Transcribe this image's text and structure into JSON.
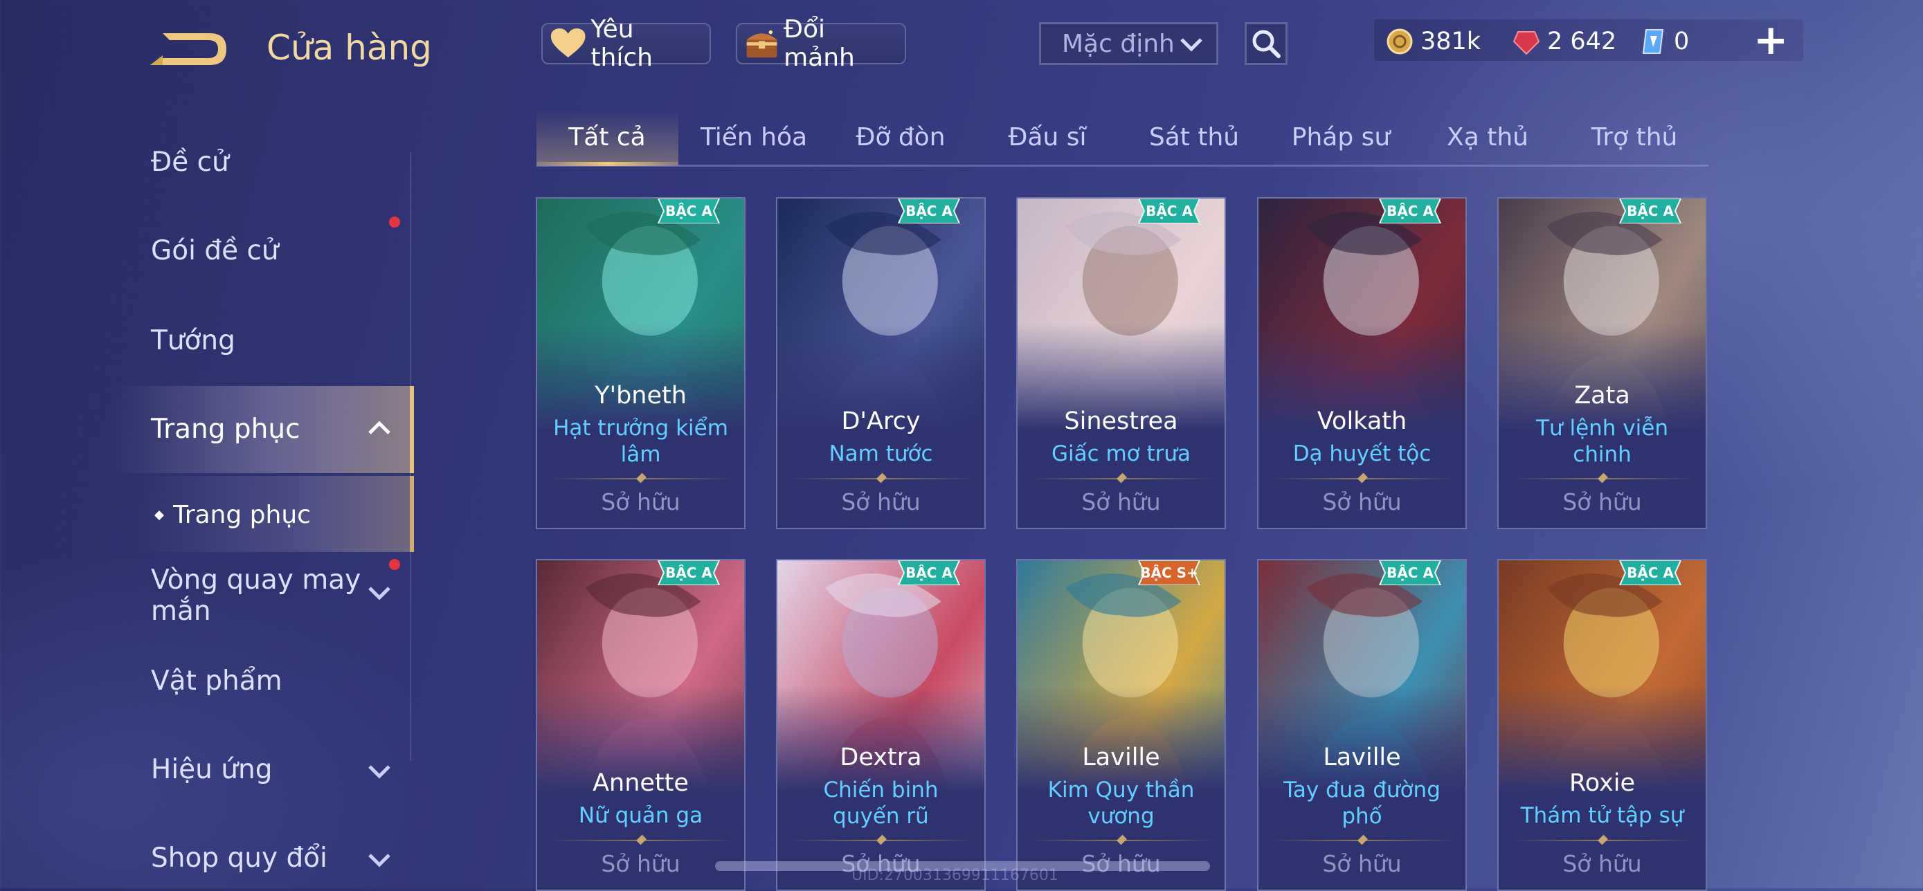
{
  "header": {
    "title": "Cửa hàng",
    "favorites_label": "Yêu thích",
    "exchange_label": "Đổi mảnh",
    "sort_value": "Mặc định",
    "currencies": [
      {
        "icon": "gold-coin-icon",
        "value": "381k"
      },
      {
        "icon": "red-gem-icon",
        "value": "2 642"
      },
      {
        "icon": "blue-ticket-icon",
        "value": "0"
      }
    ]
  },
  "sidebar": {
    "items": [
      {
        "label": "Đề cử"
      },
      {
        "label": "Gói đề cử"
      },
      {
        "label": "Tướng"
      },
      {
        "label": "Trang phục"
      },
      {
        "label": "Trang phục"
      },
      {
        "label": "Vòng quay may mắn"
      },
      {
        "label": "Vật phẩm"
      },
      {
        "label": "Hiệu ứng"
      },
      {
        "label": "Shop quy đổi"
      }
    ]
  },
  "tabs": [
    "Tất cả",
    "Tiến hóa",
    "Đỡ đòn",
    "Đấu sĩ",
    "Sát thủ",
    "Pháp sư",
    "Xạ thủ",
    "Trợ thủ"
  ],
  "cards": [
    {
      "hero": "Y'bneth",
      "skin": "Hạt trưởng kiểm lâm",
      "badge": "BẬC A",
      "status": "Sở hữu",
      "colors": [
        "#1d6b5a",
        "#2a8f86",
        "#7fe6d8"
      ]
    },
    {
      "hero": "D'Arcy",
      "skin": "Nam tước",
      "badge": "BẬC A",
      "status": "Sở hữu",
      "colors": [
        "#1e2a5a",
        "#4a5596",
        "#c6cde6"
      ]
    },
    {
      "hero": "Sinestrea",
      "skin": "Giấc mơ trưa",
      "badge": "BẬC A",
      "status": "Sở hữu",
      "colors": [
        "#c7b7c7",
        "#e8d4d6",
        "#9a7d74"
      ]
    },
    {
      "hero": "Volkath",
      "skin": "Dạ huyết tộc",
      "badge": "BẬC A",
      "status": "Sở hữu",
      "colors": [
        "#2e2440",
        "#7d2b3a",
        "#cfd2dc"
      ]
    },
    {
      "hero": "Zata",
      "skin": "Tư lệnh viễn chinh",
      "badge": "BẬC A",
      "status": "Sở hữu",
      "colors": [
        "#4a3c4c",
        "#a08a80",
        "#e2d9d9"
      ]
    },
    {
      "hero": "Annette",
      "skin": "Nữ quản ga",
      "badge": "BẬC A",
      "status": "Sở hữu",
      "colors": [
        "#5a2a36",
        "#d06a86",
        "#f0b7c4"
      ]
    },
    {
      "hero": "Dextra",
      "skin": "Chiến binh quyến rũ",
      "badge": "BẬC A",
      "status": "Sở hữu",
      "colors": [
        "#e2d6ea",
        "#c84a62",
        "#b9a9d2"
      ]
    },
    {
      "hero": "Laville",
      "skin": "Kim Quy thần vương",
      "badge": "BẬC S+",
      "status": "Sở hữu",
      "colors": [
        "#2f7a9a",
        "#d4aa44",
        "#f3df9a"
      ]
    },
    {
      "hero": "Laville",
      "skin": "Tay đua đường phố",
      "badge": "BẬC A",
      "status": "Sở hữu",
      "colors": [
        "#7a2e3a",
        "#3c8fb0",
        "#b9c4cc"
      ]
    },
    {
      "hero": "Roxie",
      "skin": "Thám tử tập sự",
      "badge": "BẬC A",
      "status": "Sở hữu",
      "colors": [
        "#7a3a24",
        "#c26a34",
        "#f0cf6a"
      ]
    }
  ],
  "footer": {
    "watermark": "UID:270031369911167601"
  },
  "accent_colors": {
    "gold": "#f0c77c",
    "skin_name": "#5fd0ff",
    "badge_a": "#1fb0a0",
    "badge_s": "#d8642a",
    "notification": "#e8343c"
  }
}
